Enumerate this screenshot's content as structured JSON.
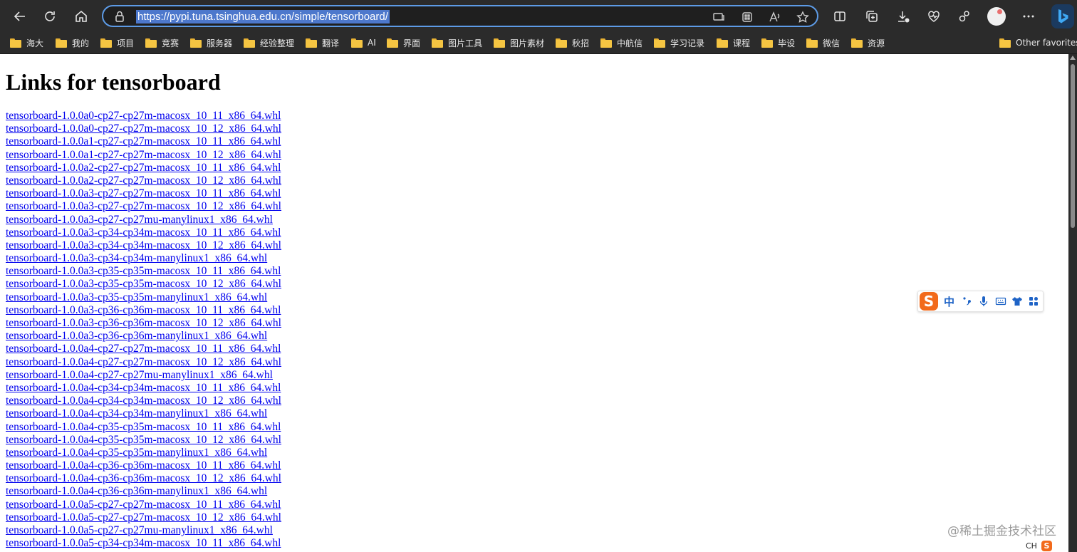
{
  "browser": {
    "url": "https://pypi.tuna.tsinghua.edu.cn/simple/tensorboard/",
    "bookmarks": [
      "海大",
      "我的",
      "项目",
      "竞赛",
      "服务器",
      "经验整理",
      "翻译",
      "AI",
      "界面",
      "图片工具",
      "图片素材",
      "秋招",
      "中航信",
      "学习记录",
      "课程",
      "毕设",
      "微信",
      "资源"
    ],
    "other_favorites": "Other favorites"
  },
  "page": {
    "title": "Links for tensorboard",
    "links": [
      "tensorboard-1.0.0a0-cp27-cp27m-macosx_10_11_x86_64.whl",
      "tensorboard-1.0.0a0-cp27-cp27m-macosx_10_12_x86_64.whl",
      "tensorboard-1.0.0a1-cp27-cp27m-macosx_10_11_x86_64.whl",
      "tensorboard-1.0.0a1-cp27-cp27m-macosx_10_12_x86_64.whl",
      "tensorboard-1.0.0a2-cp27-cp27m-macosx_10_11_x86_64.whl",
      "tensorboard-1.0.0a2-cp27-cp27m-macosx_10_12_x86_64.whl",
      "tensorboard-1.0.0a3-cp27-cp27m-macosx_10_11_x86_64.whl",
      "tensorboard-1.0.0a3-cp27-cp27m-macosx_10_12_x86_64.whl",
      "tensorboard-1.0.0a3-cp27-cp27mu-manylinux1_x86_64.whl",
      "tensorboard-1.0.0a3-cp34-cp34m-macosx_10_11_x86_64.whl",
      "tensorboard-1.0.0a3-cp34-cp34m-macosx_10_12_x86_64.whl",
      "tensorboard-1.0.0a3-cp34-cp34m-manylinux1_x86_64.whl",
      "tensorboard-1.0.0a3-cp35-cp35m-macosx_10_11_x86_64.whl",
      "tensorboard-1.0.0a3-cp35-cp35m-macosx_10_12_x86_64.whl",
      "tensorboard-1.0.0a3-cp35-cp35m-manylinux1_x86_64.whl",
      "tensorboard-1.0.0a3-cp36-cp36m-macosx_10_11_x86_64.whl",
      "tensorboard-1.0.0a3-cp36-cp36m-macosx_10_12_x86_64.whl",
      "tensorboard-1.0.0a3-cp36-cp36m-manylinux1_x86_64.whl",
      "tensorboard-1.0.0a4-cp27-cp27m-macosx_10_11_x86_64.whl",
      "tensorboard-1.0.0a4-cp27-cp27m-macosx_10_12_x86_64.whl",
      "tensorboard-1.0.0a4-cp27-cp27mu-manylinux1_x86_64.whl",
      "tensorboard-1.0.0a4-cp34-cp34m-macosx_10_11_x86_64.whl",
      "tensorboard-1.0.0a4-cp34-cp34m-macosx_10_12_x86_64.whl",
      "tensorboard-1.0.0a4-cp34-cp34m-manylinux1_x86_64.whl",
      "tensorboard-1.0.0a4-cp35-cp35m-macosx_10_11_x86_64.whl",
      "tensorboard-1.0.0a4-cp35-cp35m-macosx_10_12_x86_64.whl",
      "tensorboard-1.0.0a4-cp35-cp35m-manylinux1_x86_64.whl",
      "tensorboard-1.0.0a4-cp36-cp36m-macosx_10_11_x86_64.whl",
      "tensorboard-1.0.0a4-cp36-cp36m-macosx_10_12_x86_64.whl",
      "tensorboard-1.0.0a4-cp36-cp36m-manylinux1_x86_64.whl",
      "tensorboard-1.0.0a5-cp27-cp27m-macosx_10_11_x86_64.whl",
      "tensorboard-1.0.0a5-cp27-cp27m-macosx_10_12_x86_64.whl",
      "tensorboard-1.0.0a5-cp27-cp27mu-manylinux1_x86_64.whl",
      "tensorboard-1.0.0a5-cp34-cp34m-macosx_10_11_x86_64.whl"
    ]
  },
  "ime": {
    "logo": "S",
    "mode": "中"
  },
  "watermark": "@稀土掘金技术社区",
  "tray": {
    "lang": "CH",
    "ime_logo": "S"
  },
  "colors": {
    "link": "#0000ee",
    "address_border": "#5d9be6",
    "url_highlight": "#4d78cc",
    "folder": "#f5c542",
    "ime_accent": "#f26a1b"
  }
}
